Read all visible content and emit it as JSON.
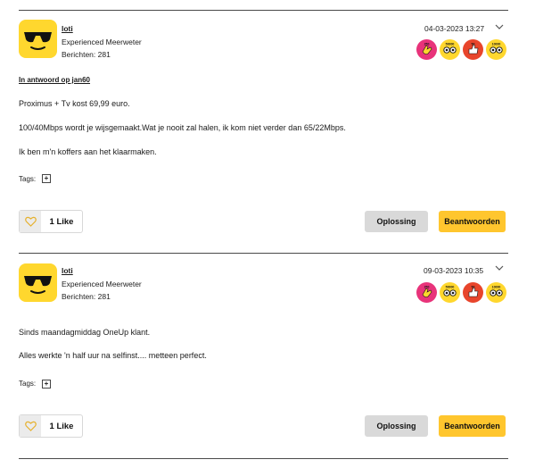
{
  "posts": [
    {
      "author": "loti",
      "rank": "Experienced Meerweter",
      "count_label": "Berichten: 281",
      "date": "04-03-2023 13:27",
      "reply_to": "In antwoord op jan60",
      "body": [
        "Proximus + Tv kost 69,99 euro.",
        "100/40Mbps wordt je wijsgemaakt.Wat je nooit zal halen, ik kom niet verder dan 65/22Mbps.",
        "Ik ben m'n koffers aan het klaarmaken."
      ],
      "tags_label": "Tags:",
      "tag_add_symbol": "+",
      "likes_label": "1 Like",
      "solution_label": "Oplossing",
      "reply_label": "Beantwoorden",
      "badges": [
        {
          "icon": "hand-badge-icon",
          "color": "#e8337a",
          "text": "250"
        },
        {
          "icon": "eyes-badge-icon",
          "color": "#ffd72e",
          "text": "50000"
        },
        {
          "icon": "thumb-badge-icon",
          "color": "#e8452c",
          "text": "50"
        },
        {
          "icon": "eyes-badge-icon",
          "color": "#ffd72e",
          "text": "10000"
        }
      ]
    },
    {
      "author": "loti",
      "rank": "Experienced Meerweter",
      "count_label": "Berichten: 281",
      "date": "09-03-2023 10:35",
      "body": [
        "Sinds maandagmiddag OneUp klant.",
        "Alles werkte 'n half uur na selfinst.... metteen perfect."
      ],
      "tags_label": "Tags:",
      "tag_add_symbol": "+",
      "likes_label": "1 Like",
      "solution_label": "Oplossing",
      "reply_label": "Beantwoorden",
      "badges": [
        {
          "icon": "hand-badge-icon",
          "color": "#e8337a",
          "text": "250"
        },
        {
          "icon": "eyes-badge-icon",
          "color": "#ffd72e",
          "text": "50000"
        },
        {
          "icon": "thumb-badge-icon",
          "color": "#e8452c",
          "text": "50"
        },
        {
          "icon": "eyes-badge-icon",
          "color": "#ffd72e",
          "text": "10000"
        }
      ]
    }
  ],
  "colors": {
    "accent": "#ffc62e",
    "avatar_bg": "#ffd72e",
    "solution_bg": "#d9d9d9"
  }
}
